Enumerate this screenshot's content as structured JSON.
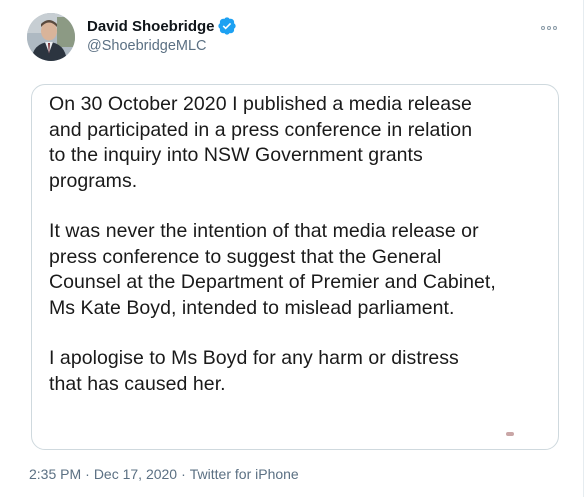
{
  "author": {
    "display_name": "David Shoebridge",
    "handle": "@ShoebridgeMLC",
    "verified": true,
    "avatar_icon": "profile-photo"
  },
  "media": {
    "paragraphs": [
      "On 30 October 2020 I published a media release\nand participated in a press conference in relation\nto the inquiry into NSW Government grants\nprograms.",
      "It was never the intention of that media release or\npress conference to suggest that the General\nCounsel at the Department of Premier and Cabinet,\nMs Kate Boyd, intended to mislead parliament.",
      "I apologise to Ms Boyd for any harm or distress\nthat has caused her."
    ]
  },
  "meta": {
    "time": "2:35 PM",
    "date": "Dec 17, 2020",
    "source": "Twitter for iPhone",
    "separator": "·"
  },
  "colors": {
    "verified_badge": "#1da1f2",
    "secondary_text": "#5b7083",
    "primary_text": "#0f1419",
    "card_border": "#cfd9de"
  }
}
